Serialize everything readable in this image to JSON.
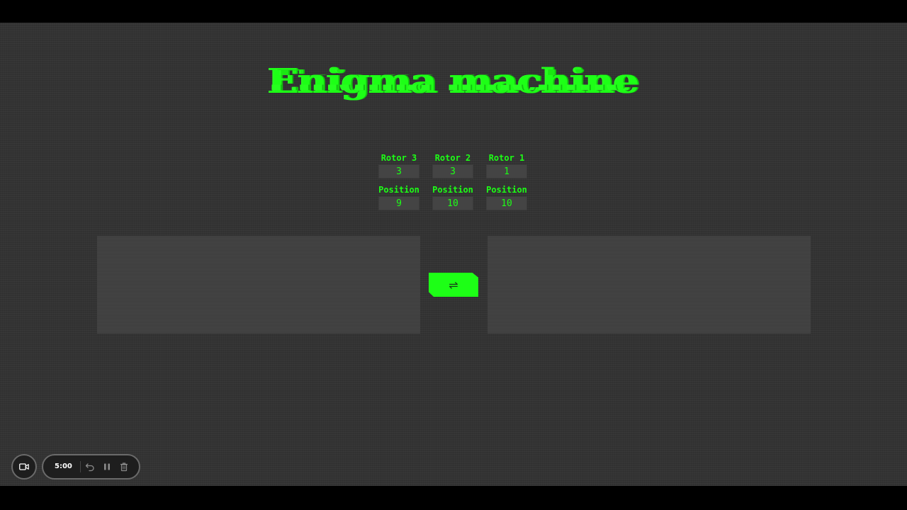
{
  "title": "Enigma machine",
  "rotors": [
    {
      "label": "Rotor 3",
      "value": "3",
      "position_label": "Position",
      "position": "9"
    },
    {
      "label": "Rotor 2",
      "value": "3",
      "position_label": "Position",
      "position": "10"
    },
    {
      "label": "Rotor 1",
      "value": "1",
      "position_label": "Position",
      "position": "10"
    }
  ],
  "input_panel": {
    "value": ""
  },
  "output_panel": {
    "value": ""
  },
  "swap_button": {
    "label": "⇌",
    "icon": "swap-arrows-icon"
  },
  "recorder": {
    "time": "5:00",
    "icons": [
      "camera-icon",
      "undo-icon",
      "pause-icon",
      "trash-icon"
    ]
  },
  "colors": {
    "accent": "#1dff16",
    "background": "#333333",
    "panel": "#3e3e3e"
  }
}
